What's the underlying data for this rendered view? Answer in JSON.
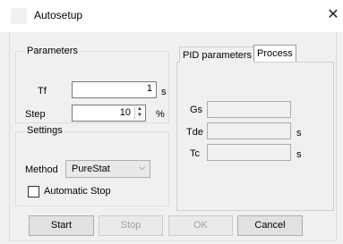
{
  "window": {
    "title": "Autosetup",
    "close_glyph": "✕",
    "icon": "app-icon"
  },
  "parameters": {
    "caption": "Parameters",
    "tf_label": "Tf",
    "tf_value": "1",
    "tf_unit": "s",
    "step_label": "Step",
    "step_value": "10",
    "step_unit": "%",
    "spin_up_icon": "▲",
    "spin_down_icon": "▼"
  },
  "settings": {
    "caption": "Settings",
    "method_label": "Method",
    "method_value": "PureStat",
    "dropdown_icon": "⌵",
    "automatic_stop_label": "Automatic Stop",
    "automatic_stop_checked": false
  },
  "tabs": {
    "items": [
      {
        "label": "PID parameters",
        "active": false
      },
      {
        "label": "Process",
        "active": true
      }
    ]
  },
  "process": {
    "gs_label": "Gs",
    "gs_value": "",
    "tde_label": "Tde",
    "tde_value": "",
    "tde_unit": "s",
    "tc_label": "Tc",
    "tc_value": "",
    "tc_unit": "s"
  },
  "buttons": {
    "start": {
      "label": "Start",
      "enabled": true
    },
    "stop": {
      "label": "Stop",
      "enabled": false
    },
    "ok": {
      "label": "OK",
      "enabled": false
    },
    "cancel": {
      "label": "Cancel",
      "enabled": true
    }
  }
}
